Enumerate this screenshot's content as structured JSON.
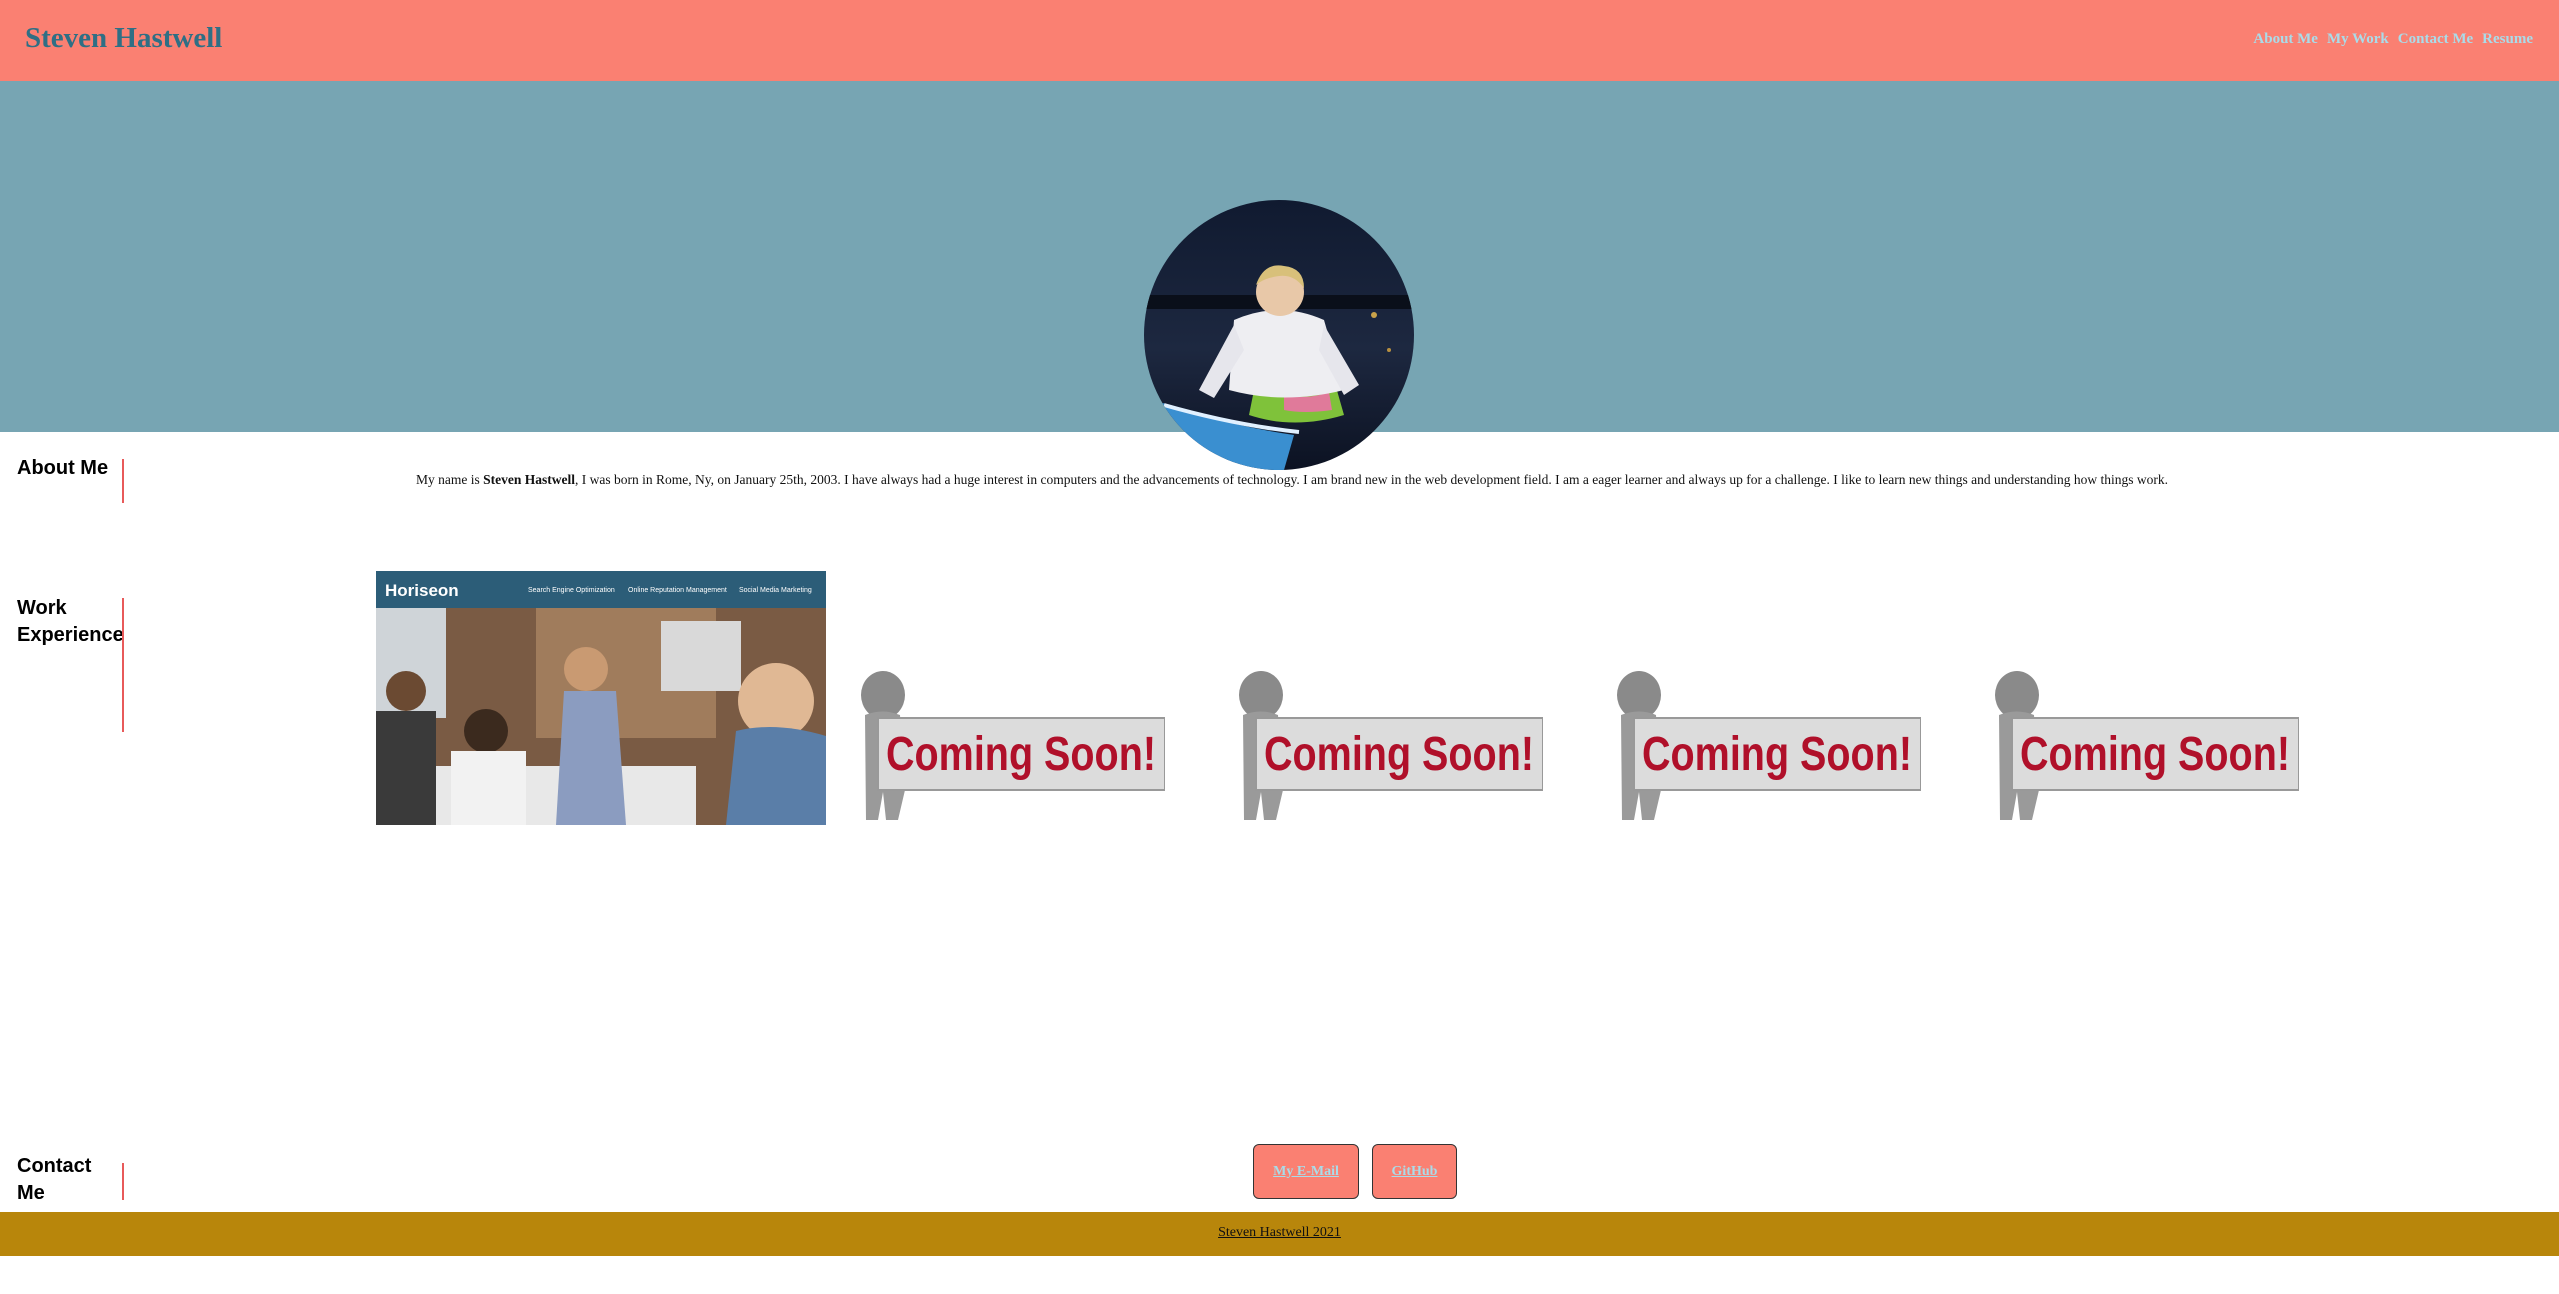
{
  "header": {
    "brand": "Steven Hastwell",
    "nav": [
      "About Me",
      "My Work",
      "Contact Me",
      "Resume"
    ]
  },
  "sections": {
    "about": "About Me",
    "work": "Work Experience",
    "contact": "Contact Me"
  },
  "about": {
    "prefix": "My name is ",
    "name": "Steven Hastwell",
    "suffix": ", I was born in Rome, Ny, on January 25th, 2003. I have always had a huge interest in computers and the advancements of technology. I am brand new in the web development field. I am a eager learner and always up for a challenge. I like to learn new things and understanding how things work."
  },
  "work": {
    "main_project": {
      "logo": "Horiseon",
      "nav": [
        "Search Engine Optimization",
        "Online Reputation Management",
        "Social Media Marketing"
      ]
    },
    "placeholder_text": "Coming Soon!"
  },
  "contact": {
    "email": "My E-Mail",
    "github": "GitHub"
  },
  "footer": {
    "text": "Steven Hastwell 2021"
  },
  "colors": {
    "header": "#fa8072",
    "hero": "#77a5b3",
    "footer": "#b8860b",
    "accent": "#e85a5a",
    "brand": "#2e6f85"
  }
}
